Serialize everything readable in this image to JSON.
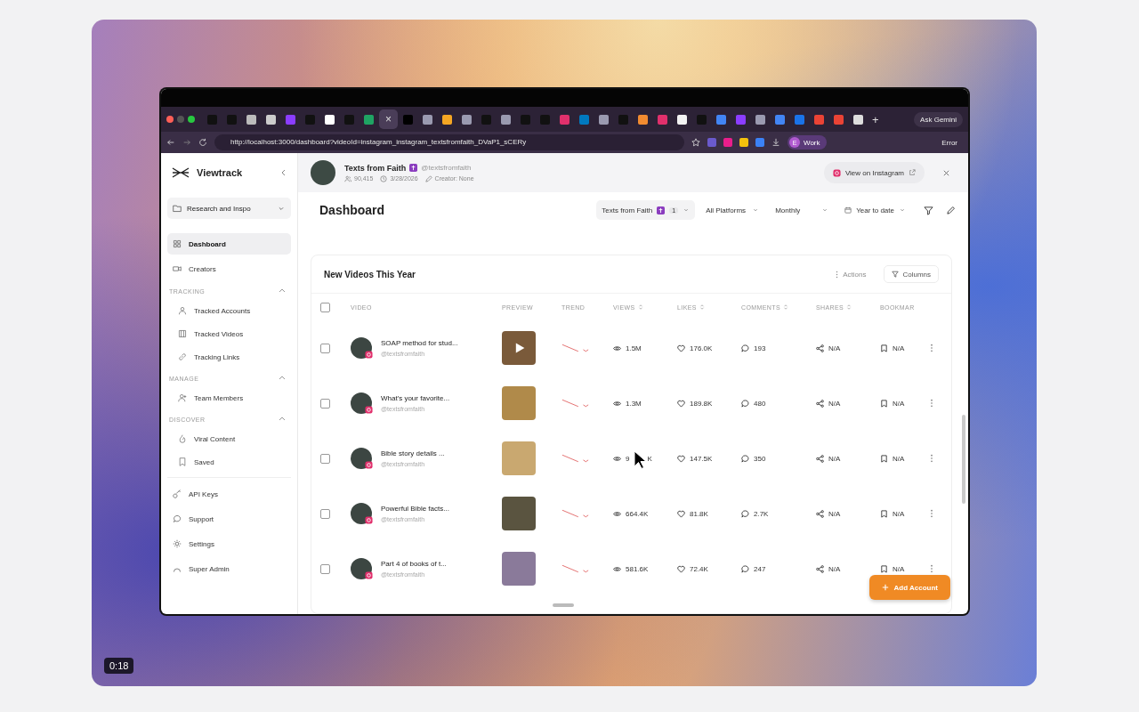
{
  "video_player": {
    "timestamp": "0:18"
  },
  "browser": {
    "tabs": [
      {
        "color": "#111111",
        "selected": false
      },
      {
        "color": "#111111",
        "selected": false
      },
      {
        "color": "#bbbbbb",
        "selected": false
      },
      {
        "color": "#cccccc",
        "selected": false
      },
      {
        "color": "#8b3dff",
        "selected": false
      },
      {
        "color": "#111111",
        "selected": false
      },
      {
        "color": "#ffffff",
        "selected": false
      },
      {
        "color": "#111111",
        "selected": false
      },
      {
        "color": "#1fa463",
        "selected": false
      },
      {
        "selected": true
      },
      {
        "color": "#000000",
        "selected": false
      },
      {
        "color": "#9a9ab0",
        "selected": false
      },
      {
        "color": "#f5a623",
        "selected": false
      },
      {
        "color": "#9a9ab0",
        "selected": false
      },
      {
        "color": "#111111",
        "selected": false
      },
      {
        "color": "#9a9ab0",
        "selected": false
      },
      {
        "color": "#111111",
        "selected": false
      },
      {
        "color": "#111111",
        "selected": false
      },
      {
        "color": "#e1306c",
        "selected": false
      },
      {
        "color": "#0079bf",
        "selected": false
      },
      {
        "color": "#9a9ab0",
        "selected": false
      },
      {
        "color": "#111111",
        "selected": false
      },
      {
        "color": "#f28b30",
        "selected": false
      },
      {
        "color": "#e1306c",
        "selected": false
      },
      {
        "color": "#f2f2f2",
        "selected": false
      },
      {
        "color": "#111111",
        "selected": false
      },
      {
        "color": "#4285f4",
        "selected": false
      },
      {
        "color": "#8b3dff",
        "selected": false
      },
      {
        "color": "#9a9ab0",
        "selected": false
      },
      {
        "color": "#4285f4",
        "selected": false
      },
      {
        "color": "#1a73e8",
        "selected": false
      },
      {
        "color": "#ea4335",
        "selected": false
      },
      {
        "color": "#ea4335",
        "selected": false
      },
      {
        "color": "#dddddd",
        "selected": false
      }
    ],
    "close_tab": "×",
    "new_tab": "+",
    "ask_button": "Ask Gemini",
    "url": "http://localhost:3000/dashboard?videoId=instagram_instagram_textsfromfaith_DVaP1_sCERy",
    "extensions": [
      {
        "color": "#6a5acd"
      },
      {
        "color": "#e91e8c"
      },
      {
        "color": "#f4c20d"
      },
      {
        "color": "#3b82f6"
      }
    ],
    "profile": {
      "initial": "E",
      "label": "Work"
    },
    "error_button": "Error"
  },
  "sidebar": {
    "brand": "Viewtrack",
    "workspace": "Research and Inspo",
    "items": [
      {
        "label": "Dashboard",
        "selected": true
      },
      {
        "label": "Creators",
        "selected": false
      }
    ],
    "sections": [
      {
        "title": "TRACKING",
        "expanded": true,
        "items": [
          {
            "label": "Tracked Accounts",
            "selected": false
          },
          {
            "label": "Tracked Videos",
            "selected": false
          },
          {
            "label": "Tracking Links",
            "selected": false
          }
        ]
      },
      {
        "title": "MANAGE",
        "expanded": true,
        "items": [
          {
            "label": "Team Members",
            "selected": false
          }
        ]
      },
      {
        "title": "DISCOVER",
        "expanded": true,
        "items": [
          {
            "label": "Viral Content",
            "selected": false
          },
          {
            "label": "Saved",
            "selected": false
          }
        ]
      }
    ],
    "footer_items": [
      {
        "label": "API Keys",
        "selected": false
      },
      {
        "label": "Support",
        "selected": false
      },
      {
        "label": "Settings",
        "selected": false
      },
      {
        "label": "Super Admin",
        "selected": false
      }
    ]
  },
  "creator": {
    "name": "Texts from Faith",
    "handle": "@textsfromfaith",
    "followers": "90,415",
    "date": "3/28/2026",
    "creator": "Creator: None",
    "view_button": "View on Instagram"
  },
  "page_title": "Dashboard",
  "filters": [
    {
      "kind": "account",
      "label": "Texts from Faith",
      "count": "1"
    },
    {
      "kind": "select",
      "label": "All Platforms"
    },
    {
      "kind": "select",
      "label": "Monthly"
    },
    {
      "kind": "date",
      "label": "Year to date"
    }
  ],
  "card": {
    "title": "New Videos This Year",
    "actions": {
      "label": "Actions",
      "disabled": true
    },
    "columns_button": "Columns",
    "select_all_checked": false,
    "columns": [
      {
        "label": "VIDEO",
        "sortable": false
      },
      {
        "label": "PREVIEW",
        "sortable": false
      },
      {
        "label": "TREND",
        "sortable": false
      },
      {
        "label": "VIEWS",
        "sortable": true
      },
      {
        "label": "LIKES",
        "sortable": true
      },
      {
        "label": "COMMENTS",
        "sortable": true
      },
      {
        "label": "SHARES",
        "sortable": true
      },
      {
        "label": "BOOKMAR",
        "sortable": false
      }
    ],
    "rows": [
      {
        "checked": false,
        "title": "SOAP method for stud...",
        "handle": "@textsfromfaith",
        "play_overlay": true,
        "views": "1.5M",
        "likes": "176.0K",
        "comments": "193",
        "shares": "N/A",
        "bookmarks": "N/A"
      },
      {
        "checked": false,
        "title": "What's your favorite...",
        "handle": "@textsfromfaith",
        "play_overlay": false,
        "views": "1.3M",
        "likes": "189.8K",
        "comments": "480",
        "shares": "N/A",
        "bookmarks": "N/A"
      },
      {
        "checked": false,
        "title": "Bible story details ...",
        "handle": "@textsfromfaith",
        "play_overlay": false,
        "views": "9",
        "views_tail": "K",
        "likes": "147.5K",
        "comments": "350",
        "shares": "N/A",
        "bookmarks": "N/A"
      },
      {
        "checked": false,
        "title": "Powerful Bible facts...",
        "handle": "@textsfromfaith",
        "play_overlay": false,
        "views": "664.4K",
        "likes": "81.8K",
        "comments": "2.7K",
        "shares": "N/A",
        "bookmarks": "N/A"
      },
      {
        "checked": false,
        "title": "Part 4 of books of t...",
        "handle": "@textsfromfaith",
        "play_overlay": false,
        "views": "581.6K",
        "likes": "72.4K",
        "comments": "247",
        "shares": "N/A",
        "bookmarks": "N/A"
      }
    ]
  },
  "add_account": "Add Account"
}
